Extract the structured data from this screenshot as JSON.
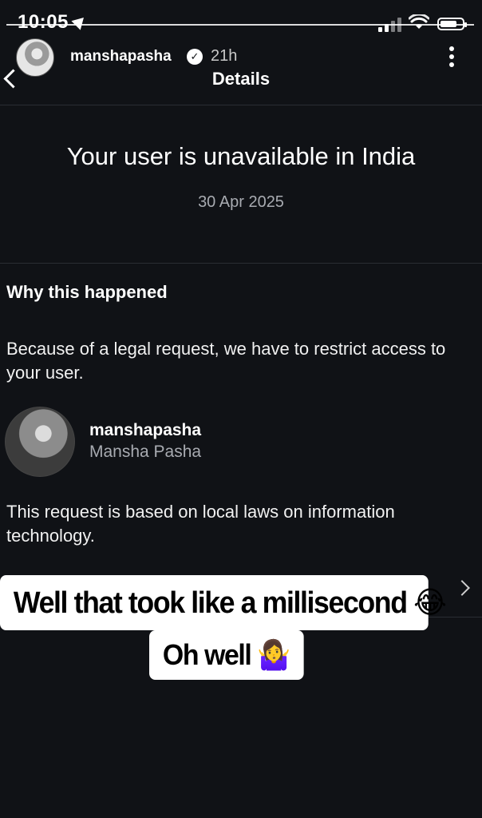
{
  "status_bar": {
    "time": "10:05",
    "icons": [
      "location-arrow-icon",
      "signal-icon",
      "wifi-icon",
      "battery-icon"
    ]
  },
  "story": {
    "username": "manshapasha",
    "verified_icon": "verified-badge-icon",
    "age": "21h",
    "more_icon": "more-vertical-icon"
  },
  "header": {
    "back_icon": "chevron-left-icon",
    "title": "Details"
  },
  "notice": {
    "headline": "Your user is unavailable in India",
    "date": "30 Apr 2025"
  },
  "reason_section": {
    "title": "Why this happened",
    "text": "Because of a legal request, we have to restrict access to your user."
  },
  "account": {
    "username": "manshapasha",
    "full_name": "Mansha Pasha"
  },
  "laws_text": "This request is based on local laws on information technology.",
  "overlay": {
    "line1": "Well that took like a millisecond",
    "line1_emoji": "😂",
    "line2": "Oh well",
    "line2_emoji": "🤷‍♀️"
  },
  "colors": {
    "background": "#101216",
    "text_primary": "#ffffff",
    "text_secondary": "#a8abb1",
    "divider": "#2a2d33",
    "sticker_background": "#ffffff"
  }
}
